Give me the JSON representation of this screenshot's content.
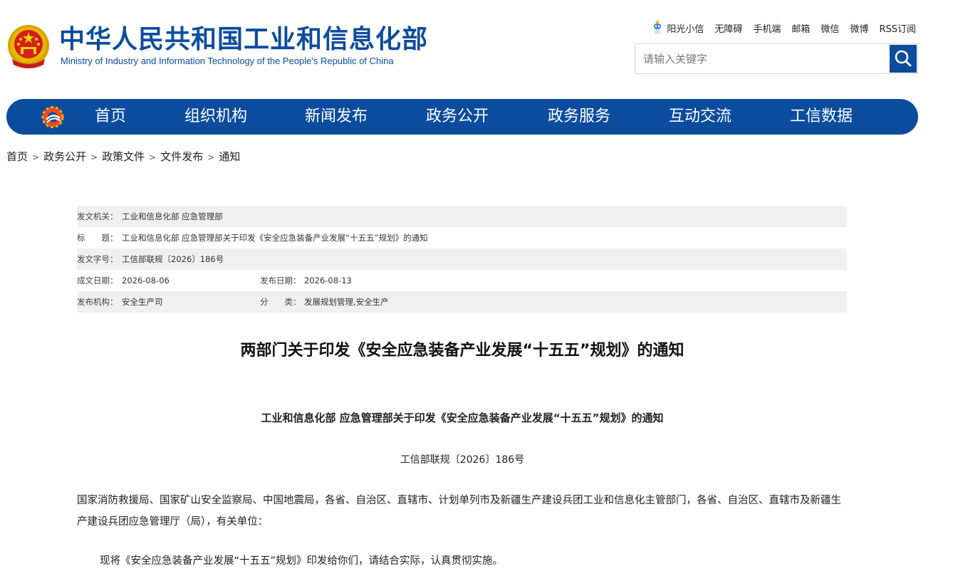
{
  "header": {
    "title": "中华人民共和国工业和信息化部",
    "subtitle": "Ministry of Industry and Information Technology of the People's Republic of China",
    "top_links": [
      "阳光小信",
      "无障碍",
      "手机端",
      "邮箱",
      "微信",
      "微博",
      "RSS订阅"
    ],
    "search": {
      "placeholder": "请输入关键字",
      "value": ""
    }
  },
  "nav": {
    "items": [
      "首页",
      "组织机构",
      "新闻发布",
      "政务公开",
      "政务服务",
      "互动交流",
      "工信数据"
    ]
  },
  "breadcrumb": [
    "首页",
    "政务公开",
    "政策文件",
    "文件发布",
    "通知"
  ],
  "meta": {
    "issuer_label": "发文机关：",
    "issuer": "工业和信息化部 应急管理部",
    "title_label": "标　　题：",
    "title": "工业和信息化部 应急管理部关于印发《安全应急装备产业发展“十五五”规划》的通知",
    "doc_no_label": "发文字号：",
    "doc_no": "工信部联规〔2026〕186号",
    "created_label": "成文日期：",
    "created": "2026-08-06",
    "published_label": "发布日期：",
    "published": "2026-08-13",
    "org_label": "发布机构：",
    "org": "安全生产司",
    "category_label": "分　　类：",
    "category": "发展规划管理,安全生产"
  },
  "article": {
    "title": "两部门关于印发《安全应急装备产业发展“十五五”规划》的通知",
    "heading": "工业和信息化部 应急管理部关于印发《安全应急装备产业发展“十五五”规划》的通知",
    "doc_number": "工信部联规〔2026〕186号",
    "recipients": "国家消防救援局、国家矿山安全监察局、中国地震局，各省、自治区、直辖市、计划单列市及新疆生产建设兵团工业和信息化主管部门，各省、自治区、直辖市及新疆生产建设兵团应急管理厅（局），有关单位：",
    "body": "现将《安全应急装备产业发展“十五五”规划》印发给你们，请结合实际，认真贯彻实施。"
  },
  "colors": {
    "brand_blue": "#0b4c9e",
    "meta_shade": "#f0f0f0"
  },
  "icons": {
    "emblem": "national-emblem-icon",
    "robot": "robot-assistant-icon",
    "search": "search-icon",
    "nav_logo": "ministry-logo-icon"
  }
}
